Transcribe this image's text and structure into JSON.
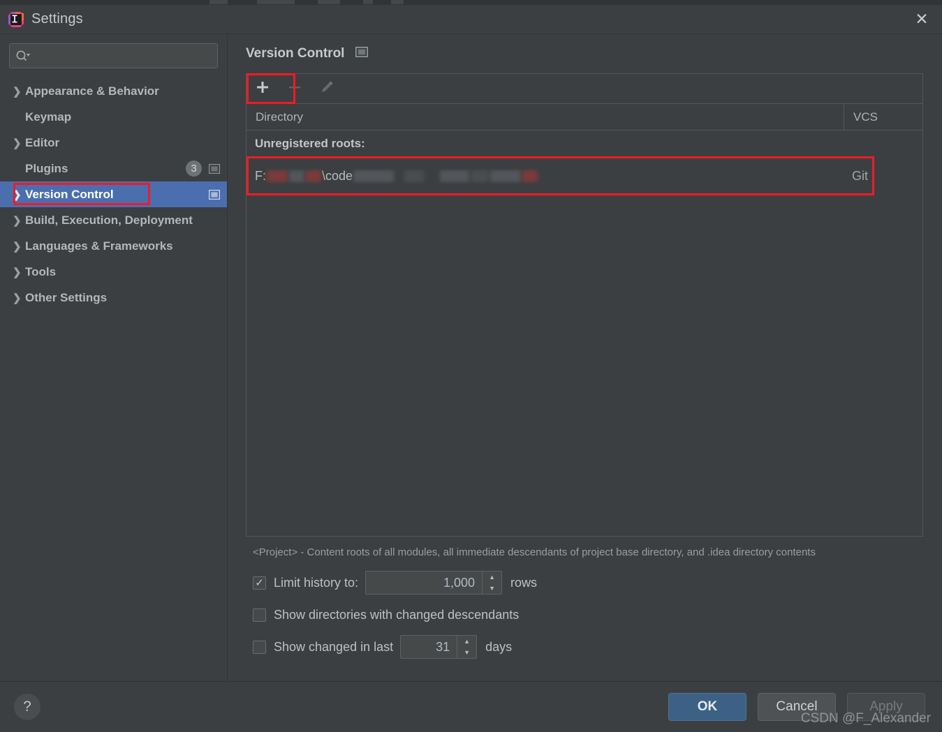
{
  "window": {
    "title": "Settings",
    "app_icon": "intellij-idea-logo",
    "close_label": "✕"
  },
  "sidebar": {
    "search": {
      "placeholder": "",
      "value": "",
      "icon": "search-icon"
    },
    "items": [
      {
        "label": "Appearance & Behavior",
        "expandable": true,
        "selected": false,
        "badge": "",
        "scope_icon": false
      },
      {
        "label": "Keymap",
        "expandable": false,
        "selected": false,
        "badge": "",
        "scope_icon": false
      },
      {
        "label": "Editor",
        "expandable": true,
        "selected": false,
        "badge": "",
        "scope_icon": false
      },
      {
        "label": "Plugins",
        "expandable": false,
        "selected": false,
        "badge": "3",
        "scope_icon": true
      },
      {
        "label": "Version Control",
        "expandable": true,
        "selected": true,
        "badge": "",
        "scope_icon": true
      },
      {
        "label": "Build, Execution, Deployment",
        "expandable": true,
        "selected": false,
        "badge": "",
        "scope_icon": false
      },
      {
        "label": "Languages & Frameworks",
        "expandable": true,
        "selected": false,
        "badge": "",
        "scope_icon": false
      },
      {
        "label": "Tools",
        "expandable": true,
        "selected": false,
        "badge": "",
        "scope_icon": false
      },
      {
        "label": "Other Settings",
        "expandable": true,
        "selected": false,
        "badge": "",
        "scope_icon": false
      }
    ]
  },
  "main": {
    "title": "Version Control",
    "title_scope_icon": "project-scope-icon",
    "toolbar": {
      "add_label": "+",
      "remove_label": "–",
      "edit_label": "edit-pencil-icon"
    },
    "table": {
      "columns": [
        "Directory",
        "VCS"
      ],
      "group_row_label": "Unregistered roots:",
      "rows": [
        {
          "directory_prefix": "F:",
          "directory_middle": "\\code",
          "directory_redacted": true,
          "vcs": "Git"
        }
      ]
    },
    "hint": "<Project> - Content roots of all modules, all immediate descendants of project base directory, and .idea directory contents",
    "options": [
      {
        "label": "Limit history to:",
        "checked": true,
        "value": "1,000",
        "suffix": "rows",
        "has_spinner": true
      },
      {
        "label": "Show directories with changed descendants",
        "checked": false,
        "value": "",
        "suffix": "",
        "has_spinner": false
      },
      {
        "label": "Show changed in last",
        "checked": false,
        "value": "31",
        "suffix": "days",
        "has_spinner": true
      }
    ]
  },
  "footer": {
    "help_label": "?",
    "ok_label": "OK",
    "cancel_label": "Cancel",
    "apply_label": "Apply"
  },
  "watermark": "CSDN @F_Alexander",
  "colors": {
    "accent_selected": "#4b6eaf",
    "highlight_red": "#ef1b26",
    "primary_button": "#3d6185",
    "panel_bg": "#3c3f41"
  }
}
